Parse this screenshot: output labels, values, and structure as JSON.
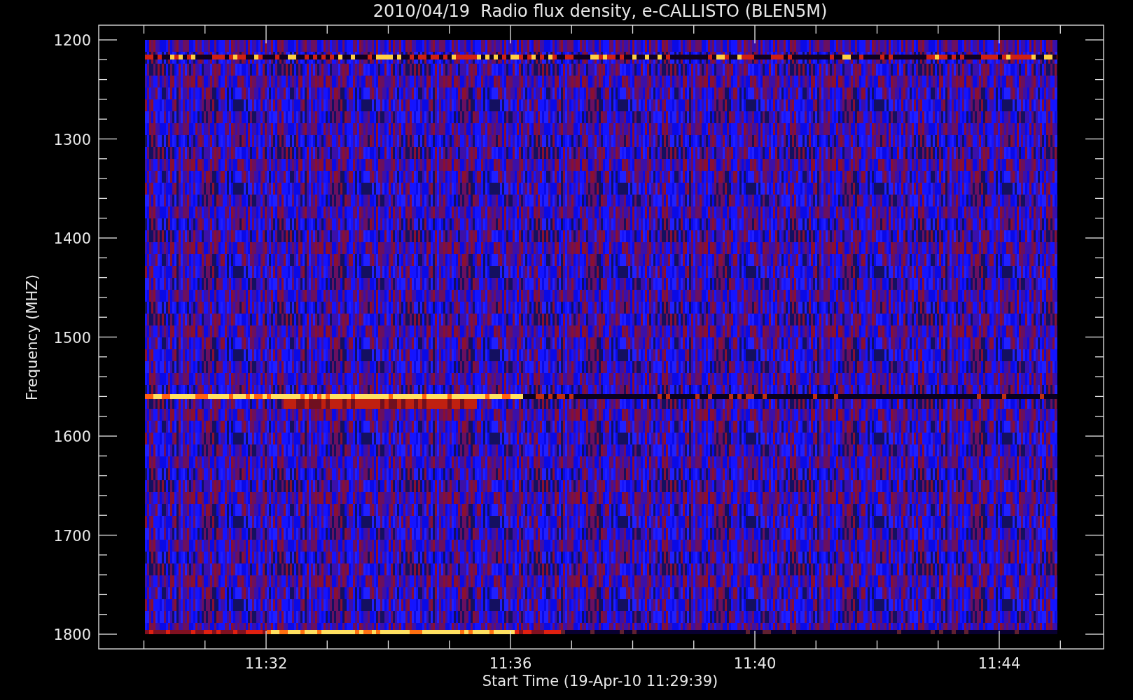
{
  "title": "2010/04/19  Radio flux density, e-CALLISTO (BLEN5M)",
  "y_axis": {
    "label": "Frequency (MHZ)",
    "ticks": [
      "1200",
      "1300",
      "1400",
      "1500",
      "1600",
      "1700",
      "1800"
    ]
  },
  "x_axis": {
    "label": "Start Time (19-Apr-10 11:29:39)",
    "ticks": [
      "11:32",
      "11:36",
      "11:40",
      "11:44"
    ]
  }
}
